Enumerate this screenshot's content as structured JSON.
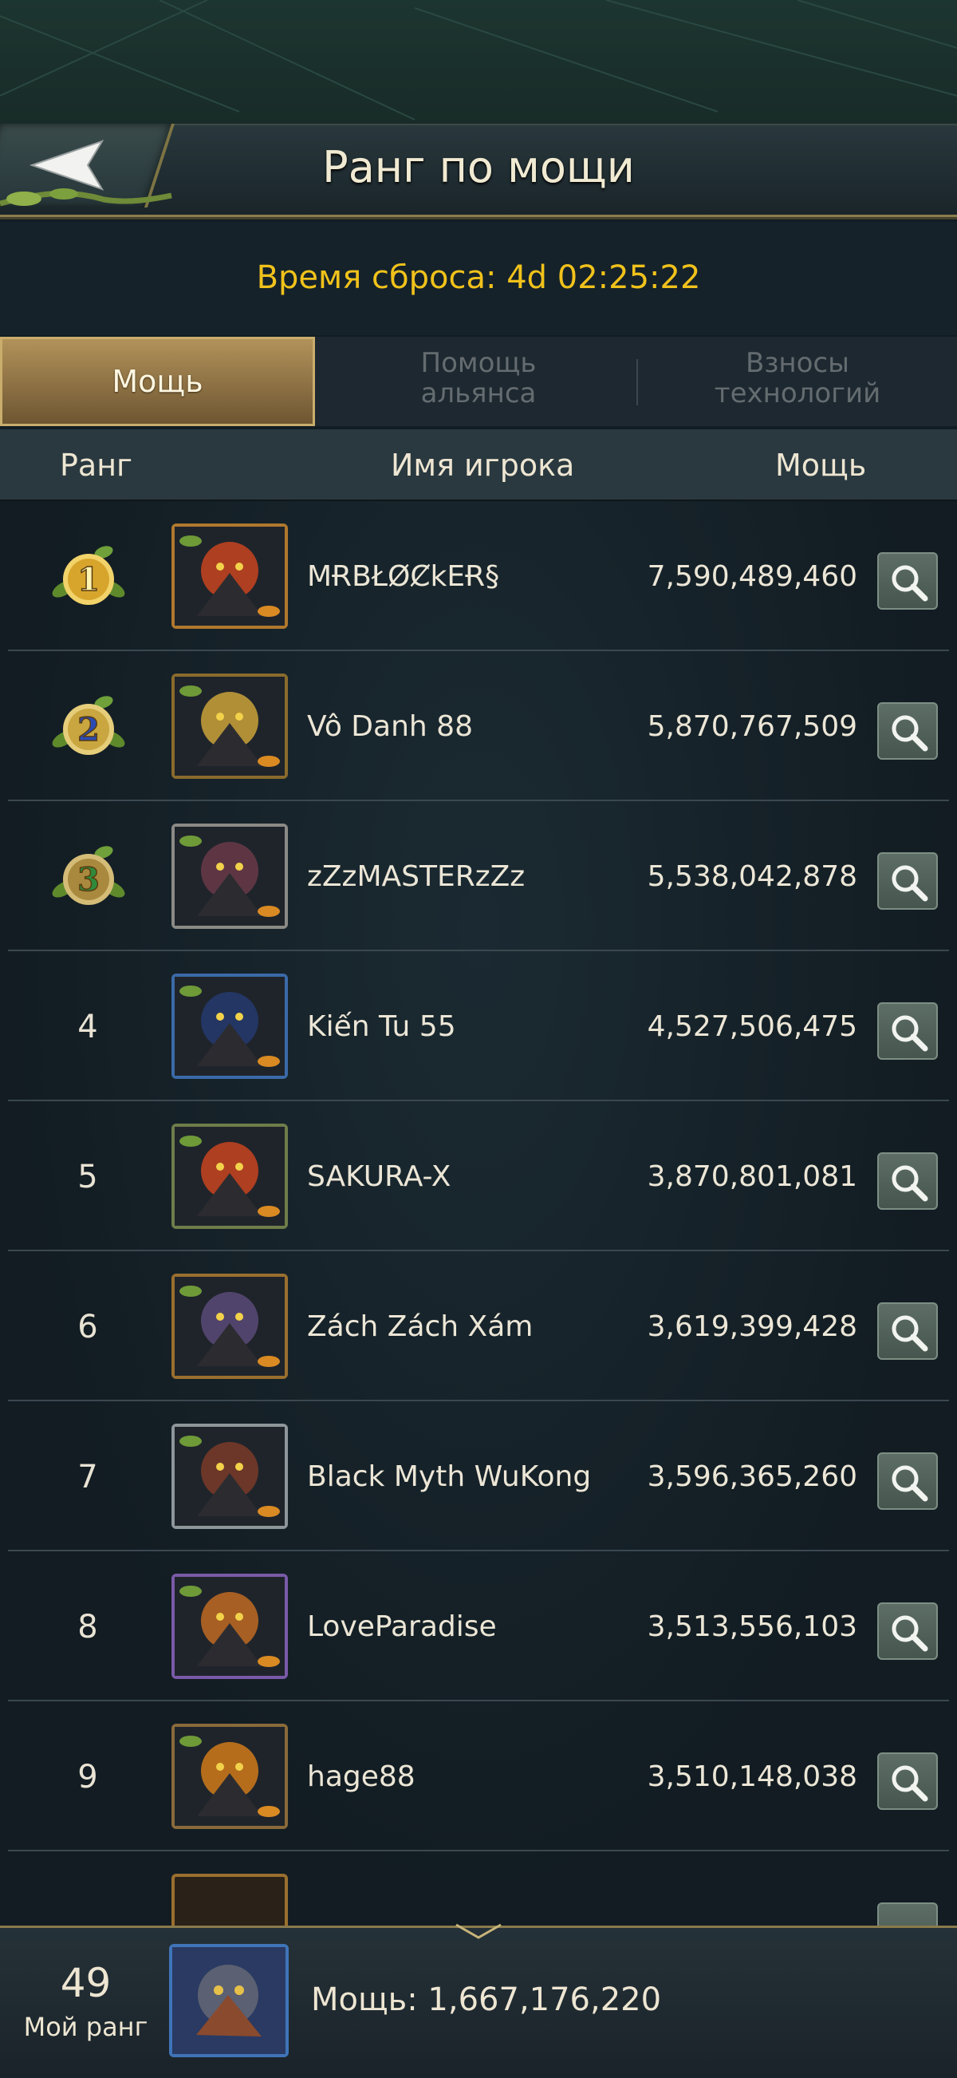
{
  "header": {
    "title": "Ранг по мощи",
    "reset_text": "Время сброса: 4d 02:25:22"
  },
  "tabs": [
    {
      "label": "Мощь",
      "active": true
    },
    {
      "label": "Помощь альянса",
      "active": false
    },
    {
      "label": "Взносы технологий",
      "active": false
    }
  ],
  "columns": {
    "rank": "Ранг",
    "player": "Имя игрока",
    "power": "Мощь"
  },
  "rows": [
    {
      "rank": "1",
      "name": "MɌBŁØȻkEɌ§",
      "power": "7,590,489,460",
      "frame": "#b0782e",
      "accent": "#c8441f"
    },
    {
      "rank": "2",
      "name": "Vô Danh 88",
      "power": "5,870,767,509",
      "frame": "#8a6b2c",
      "accent": "#caa23a"
    },
    {
      "rank": "3",
      "name": "zZzMASTERzZz",
      "power": "5,538,042,878",
      "frame": "#8b8a86",
      "accent": "#6a3a48"
    },
    {
      "rank": "4",
      "name": "Kiến Tu 55",
      "power": "4,527,506,475",
      "frame": "#3b6aa8",
      "accent": "#243a6e"
    },
    {
      "rank": "5",
      "name": "SAKURA-X",
      "power": "3,870,801,081",
      "frame": "#6f7d4a",
      "accent": "#c8441f"
    },
    {
      "rank": "6",
      "name": "Zách Zách Xám",
      "power": "3,619,399,428",
      "frame": "#9a6f2e",
      "accent": "#5b4a78"
    },
    {
      "rank": "7",
      "name": "Black Myth WuKong",
      "power": "3,596,365,260",
      "frame": "#8e969a",
      "accent": "#7a3b28"
    },
    {
      "rank": "8",
      "name": "LoveParadise",
      "power": "3,513,556,103",
      "frame": "#7a5aa8",
      "accent": "#c06a22"
    },
    {
      "rank": "9",
      "name": "hage88",
      "power": "3,510,148,038",
      "frame": "#8a6a3a",
      "accent": "#d07a1a"
    }
  ],
  "footer": {
    "my_rank": "49",
    "my_rank_label": "Мой ранг",
    "my_power": "Мощь: 1,667,176,220"
  },
  "icons": {
    "back": "back-arrow-icon",
    "search": "magnifier-icon",
    "medals": [
      "gold-medal-1-icon",
      "silver-medal-2-icon",
      "bronze-medal-3-icon"
    ]
  },
  "colors": {
    "reset_text": "#f1c21b",
    "active_tab": "#b2925a",
    "gold_trim": "#8b7c4d"
  }
}
